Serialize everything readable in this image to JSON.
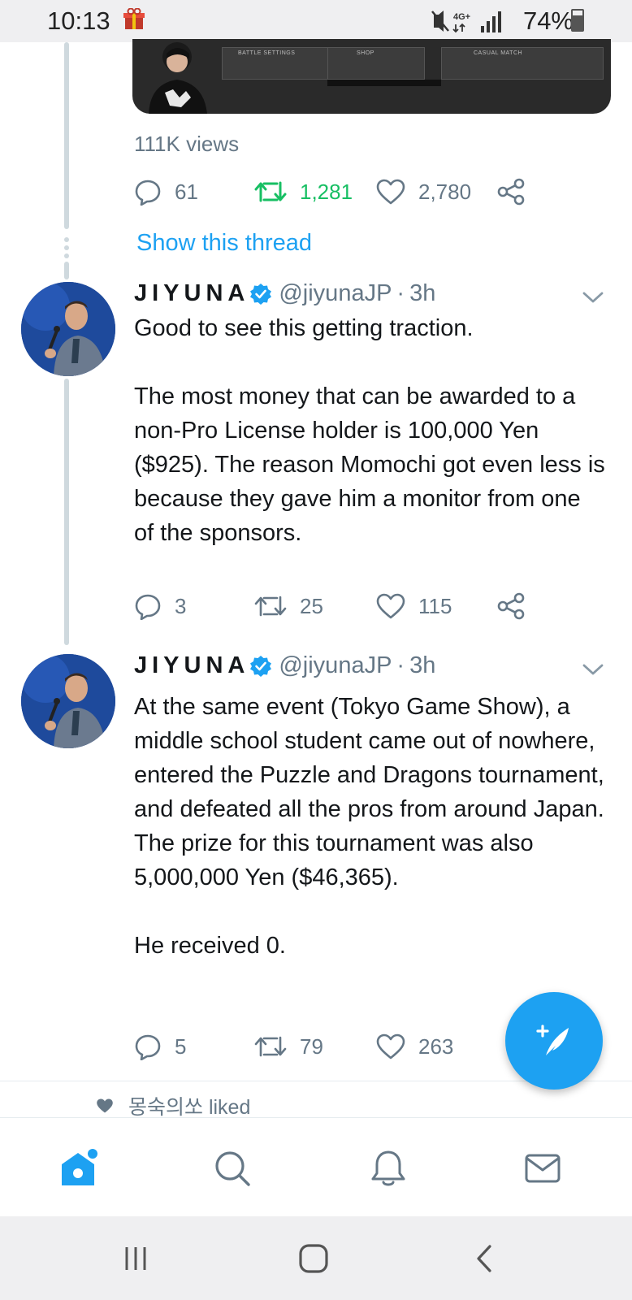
{
  "status_bar": {
    "time": "10:13",
    "network": "4G+",
    "battery_percent": "74%",
    "battery_level": 0.74
  },
  "previous_tweet": {
    "media": {
      "menu_left": "BATTLE SETTINGS",
      "menu_middle": "SHOP",
      "menu_right": "CASUAL MATCH"
    },
    "views": "111K views",
    "replies": "61",
    "retweets": "1,281",
    "likes": "2,780"
  },
  "show_thread": "Show this thread",
  "tweets": [
    {
      "author": "JIYUNA",
      "handle": "@jiyunaJP",
      "separator": "·",
      "time": "3h",
      "text": "Good to see this getting traction.\n\nThe most money that can be awarded to a non-Pro License holder is 100,000 Yen ($925). The reason Momochi got even less is because they gave him a monitor from one of the sponsors.",
      "replies": "3",
      "retweets": "25",
      "likes": "115"
    },
    {
      "author": "JIYUNA",
      "handle": "@jiyunaJP",
      "separator": "·",
      "time": "3h",
      "text": "At the same event (Tokyo Game Show), a middle school student came out of nowhere, entered the Puzzle and Dragons tournament, and defeated all the pros from around Japan. The prize for this tournament was also 5,000,000 Yen ($46,365).\n\nHe received 0.",
      "replies": "5",
      "retweets": "79",
      "likes": "263"
    }
  ],
  "liked_notice": "몽숙의쏘 liked",
  "colors": {
    "accent": "#1da1f2",
    "retweet_active": "#17bf63",
    "muted": "#657786",
    "verified": "#1da1f2"
  },
  "icons": {
    "nav": [
      "home-icon",
      "search-icon",
      "notifications-icon",
      "messages-icon"
    ],
    "actions": [
      "reply-icon",
      "retweet-icon",
      "like-icon",
      "share-icon"
    ],
    "system": [
      "recents-icon",
      "home-button-icon",
      "back-icon"
    ]
  }
}
